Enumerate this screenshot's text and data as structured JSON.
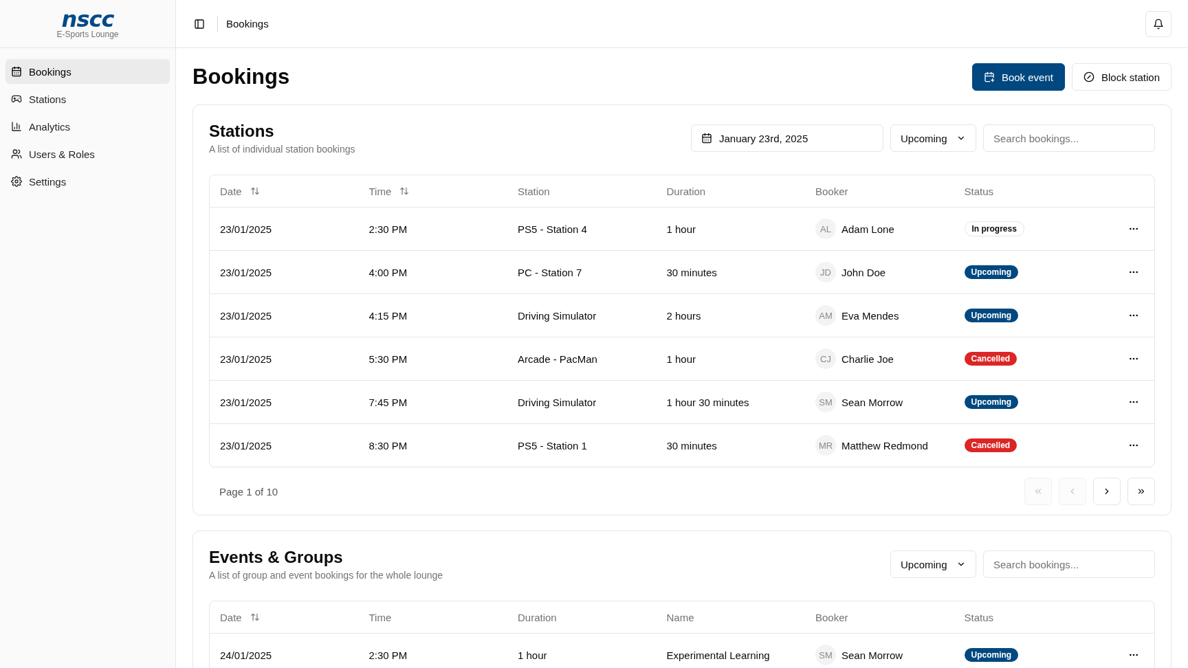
{
  "sidebar": {
    "logo": "nscc",
    "subtitle": "E-Sports Lounge",
    "items": [
      {
        "label": "Bookings",
        "selected": true
      },
      {
        "label": "Stations",
        "selected": false
      },
      {
        "label": "Analytics",
        "selected": false
      },
      {
        "label": "Users & Roles",
        "selected": false
      },
      {
        "label": "Settings",
        "selected": false
      }
    ]
  },
  "topbar": {
    "breadcrumb": "Bookings"
  },
  "page": {
    "title": "Bookings",
    "buttons": [
      {
        "label": "Book event",
        "kind": "primary"
      },
      {
        "label": "Block station",
        "kind": "outline"
      }
    ]
  },
  "sections": [
    {
      "title": "Stations",
      "subtitle": "A list of individual station bookings",
      "date": "January 23rd, 2025",
      "filter": "Upcoming",
      "search": {
        "placeholder": "Search bookings..."
      },
      "columns": [
        {
          "label": "Date",
          "sortable": true
        },
        {
          "label": "Time",
          "sortable": true
        },
        {
          "label": "Station",
          "sortable": false
        },
        {
          "label": "Duration",
          "sortable": false
        },
        {
          "label": "Booker",
          "sortable": false
        },
        {
          "label": "Status",
          "sortable": false
        }
      ],
      "rows": [
        {
          "cells": [
            "23/01/2025",
            "2:30 PM",
            "PS5 - Station 4",
            "1 hour"
          ],
          "initials": "AL",
          "booker": "Adam Lone",
          "status": "In progress",
          "kind": "progress"
        },
        {
          "cells": [
            "23/01/2025",
            "4:00 PM",
            "PC - Station 7",
            "30 minutes"
          ],
          "initials": "JD",
          "booker": "John Doe",
          "status": "Upcoming",
          "kind": "upcoming"
        },
        {
          "cells": [
            "23/01/2025",
            "4:15 PM",
            "Driving Simulator",
            "2 hours"
          ],
          "initials": "AM",
          "booker": "Eva Mendes",
          "status": "Upcoming",
          "kind": "upcoming"
        },
        {
          "cells": [
            "23/01/2025",
            "5:30 PM",
            "Arcade - PacMan",
            "1 hour"
          ],
          "initials": "CJ",
          "booker": "Charlie Joe",
          "status": "Cancelled",
          "kind": "cancelled"
        },
        {
          "cells": [
            "23/01/2025",
            "7:45 PM",
            "Driving Simulator",
            "1 hour 30 minutes"
          ],
          "initials": "SM",
          "booker": "Sean Morrow",
          "status": "Upcoming",
          "kind": "upcoming"
        },
        {
          "cells": [
            "23/01/2025",
            "8:30 PM",
            "PS5 - Station 1",
            "30 minutes"
          ],
          "initials": "MR",
          "booker": "Matthew Redmond",
          "status": "Cancelled",
          "kind": "cancelled"
        }
      ],
      "pagination": {
        "label": "Page 1 of 10",
        "buttons": [
          {
            "kind": "first",
            "disabled": true
          },
          {
            "kind": "prev",
            "disabled": true
          },
          {
            "kind": "next",
            "disabled": false
          },
          {
            "kind": "last",
            "disabled": false
          }
        ]
      }
    },
    {
      "title": "Events & Groups",
      "subtitle": "A list of group and event bookings for the whole lounge",
      "filter": "Upcoming",
      "search": {
        "placeholder": "Search bookings..."
      },
      "columns": [
        {
          "label": "Date",
          "sortable": true
        },
        {
          "label": "Time",
          "sortable": false
        },
        {
          "label": "Duration",
          "sortable": false
        },
        {
          "label": "Name",
          "sortable": false
        },
        {
          "label": "Booker",
          "sortable": false
        },
        {
          "label": "Status",
          "sortable": false
        }
      ],
      "rows": [
        {
          "cells": [
            "24/01/2025",
            "2:30 PM",
            "1 hour",
            "Experimental Learning"
          ],
          "initials": "SM",
          "booker": "Sean Morrow",
          "status": "Upcoming",
          "kind": "upcoming"
        }
      ]
    }
  ]
}
